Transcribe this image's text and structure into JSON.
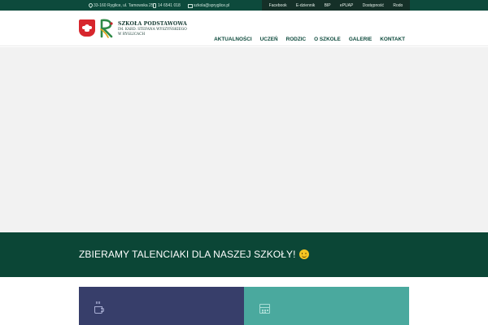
{
  "topbar": {
    "address": "33-160 Ryglice, ul. Tarnowska 25",
    "phone": "14 6541 018",
    "email": "szkola@spryglice.pl",
    "links": [
      "Facebook",
      "E-dziennik",
      "BIP",
      "ePUAP",
      "Dostępność",
      "Rodo"
    ]
  },
  "header": {
    "school_name_line1": "SZKOŁA PODSTAWOWA",
    "school_name_line2": "IM. KARD. STEFANA WYSZYŃSKIEGO",
    "school_name_line3": "W RYGLICACH",
    "nav": [
      "AKTUALNOŚCI",
      "UCZEŃ",
      "RODZIC",
      "O SZKOLE",
      "GALERIE",
      "KONTAKT"
    ]
  },
  "banner": {
    "text": "ZBIERAMY TALENCIAKI DLA NASZEJ SZKOŁY!"
  },
  "colors": {
    "topbar": "#0d4a3c",
    "toplinks": "#153028",
    "banner": "#0b4636",
    "card_left": "#373e6a",
    "card_right": "#4aa99e"
  },
  "icons": [
    "map-pin-icon",
    "phone-icon",
    "mail-icon",
    "coffee-cup-icon",
    "calendar-icon",
    "smile-emoji-icon"
  ]
}
